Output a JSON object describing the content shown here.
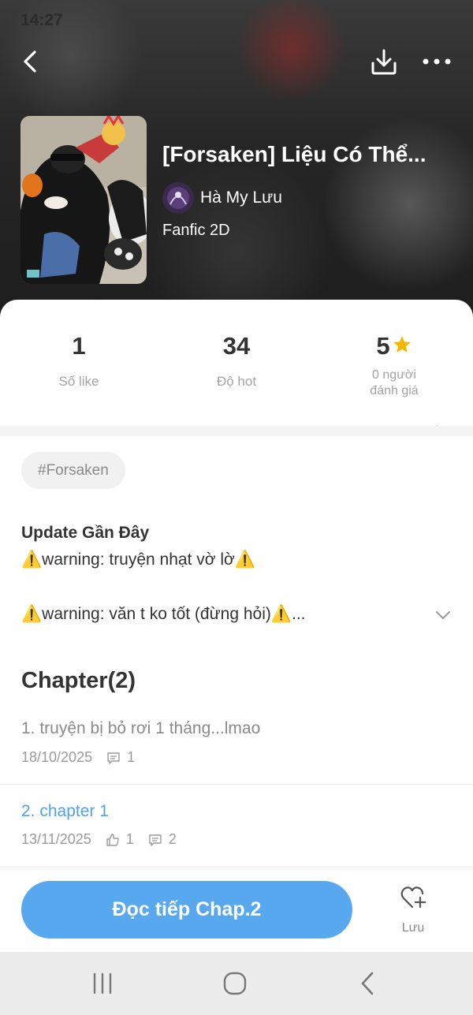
{
  "status_bar": {
    "time": "14:27"
  },
  "header": {
    "back_icon": "chevron-left-icon",
    "download_icon": "download-icon",
    "more_icon": "more-horizontal-icon"
  },
  "book": {
    "title": "[Forsaken] Liệu Có Thể...",
    "author": "Hà My Lưu",
    "genre": "Fanfic 2D"
  },
  "stats": {
    "likes": {
      "value": "1",
      "label": "Số like"
    },
    "hot": {
      "value": "34",
      "label": "Độ hot"
    },
    "rating": {
      "value": "5",
      "label_line1": "0 người",
      "label_line2": "đánh giá",
      "star_color": "#f5b800"
    }
  },
  "tag": "#Forsaken",
  "update": {
    "title": "Update Gần Đây",
    "line1": "⚠️warning: truyện nhạt vờ lờ⚠️",
    "line2": "⚠️warning: văn t ko tốt (đừng hỏi)⚠️..."
  },
  "chapters": {
    "header": "Chapter(2)",
    "items": [
      {
        "name": "1. truyện bị bỏ rơi 1 tháng...lmao",
        "date": "18/10/2025",
        "comments": "1"
      },
      {
        "name": "2. chapter 1",
        "date": "13/11/2025",
        "likes": "1",
        "comments": "2"
      }
    ]
  },
  "actions": {
    "read_label": "Đọc tiếp Chap.2",
    "save_label": "Lưu",
    "accent": "#58a8f0"
  }
}
